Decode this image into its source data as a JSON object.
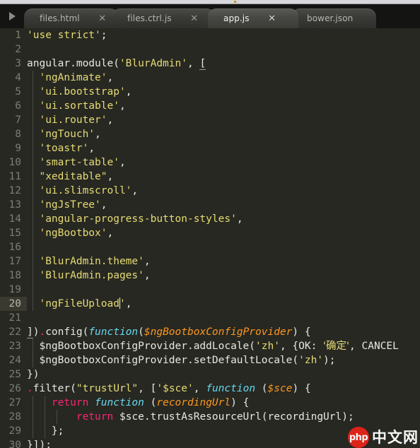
{
  "window": {
    "title": "app.js"
  },
  "tabbar": {
    "scroll_arrow_icon": "triangle-right-icon",
    "close_icon": "close-icon",
    "tabs": [
      {
        "label": "files.html",
        "close": "✕",
        "active": false
      },
      {
        "label": "files.ctrl.js",
        "close": "✕",
        "active": false
      },
      {
        "label": "app.js",
        "close": "✕",
        "active": true
      },
      {
        "label": "bower.json",
        "close": "",
        "active": false
      }
    ]
  },
  "editor": {
    "active_line": 20,
    "cursor_line": 20,
    "colors": {
      "background": "#272822",
      "gutter_text": "#7d7d72",
      "active_line_gutter": "#3a3a31",
      "foreground": "#e8e8e3",
      "string": "#e6db74",
      "keyword": "#66d9ef",
      "return_keyword": "#f92672",
      "parameter": "#fd971f",
      "punctuation_accent": "#f92672"
    },
    "lines": [
      {
        "n": "1",
        "text": "'use strict';"
      },
      {
        "n": "2",
        "text": ""
      },
      {
        "n": "3",
        "text": "angular.module('BlurAdmin', ["
      },
      {
        "n": "4",
        "text": "  'ngAnimate',"
      },
      {
        "n": "5",
        "text": "  'ui.bootstrap',"
      },
      {
        "n": "6",
        "text": "  'ui.sortable',"
      },
      {
        "n": "7",
        "text": "  'ui.router',"
      },
      {
        "n": "8",
        "text": "  'ngTouch',"
      },
      {
        "n": "9",
        "text": "  'toastr',"
      },
      {
        "n": "10",
        "text": "  'smart-table',"
      },
      {
        "n": "11",
        "text": "  \"xeditable\","
      },
      {
        "n": "12",
        "text": "  'ui.slimscroll',"
      },
      {
        "n": "13",
        "text": "  'ngJsTree',"
      },
      {
        "n": "14",
        "text": "  'angular-progress-button-styles',"
      },
      {
        "n": "15",
        "text": "  'ngBootbox',"
      },
      {
        "n": "16",
        "text": ""
      },
      {
        "n": "17",
        "text": "  'BlurAdmin.theme',"
      },
      {
        "n": "18",
        "text": "  'BlurAdmin.pages',"
      },
      {
        "n": "19",
        "text": ""
      },
      {
        "n": "20",
        "text": "  'ngFileUpload',"
      },
      {
        "n": "21",
        "text": ""
      },
      {
        "n": "22",
        "text": "]).config(function($ngBootboxConfigProvider) {"
      },
      {
        "n": "23",
        "text": "  $ngBootboxConfigProvider.addLocale('zh', {OK: '确定', CANCEL"
      },
      {
        "n": "24",
        "text": "  $ngBootboxConfigProvider.setDefaultLocale('zh');"
      },
      {
        "n": "25",
        "text": "})"
      },
      {
        "n": "26",
        "text": ".filter(\"trustUrl\", ['$sce', function ($sce) {"
      },
      {
        "n": "27",
        "text": "    return function (recordingUrl) {"
      },
      {
        "n": "28",
        "text": "        return $sce.trustAsResourceUrl(recordingUrl);"
      },
      {
        "n": "29",
        "text": "    };"
      },
      {
        "n": "30",
        "text": "}]);"
      }
    ]
  },
  "watermark": {
    "badge_text": "php",
    "text": "中文网",
    "badge_color": "#e2231a"
  }
}
